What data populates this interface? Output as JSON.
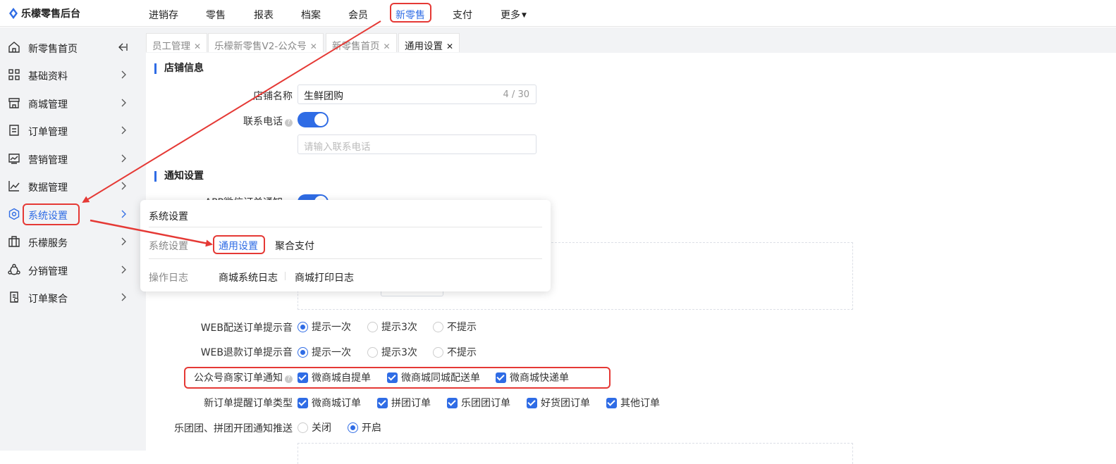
{
  "app": {
    "title": "乐檬零售后台"
  },
  "topnav": [
    "进销存",
    "零售",
    "报表",
    "档案",
    "会员",
    "新零售",
    "支付",
    "更多"
  ],
  "sidebar": {
    "items": [
      {
        "label": "新零售首页",
        "icon": "home-icon"
      },
      {
        "label": "基础资料",
        "icon": "grid-icon"
      },
      {
        "label": "商城管理",
        "icon": "store-icon"
      },
      {
        "label": "订单管理",
        "icon": "order-icon"
      },
      {
        "label": "营销管理",
        "icon": "marketing-icon"
      },
      {
        "label": "数据管理",
        "icon": "chart-icon"
      },
      {
        "label": "系统设置",
        "icon": "hexagon-settings-icon"
      },
      {
        "label": "乐檬服务",
        "icon": "briefcase-icon"
      },
      {
        "label": "分销管理",
        "icon": "share-icon"
      },
      {
        "label": "订单聚合",
        "icon": "clipboard-icon"
      }
    ]
  },
  "tabs": [
    "员工管理",
    "乐檬新零售V2-公众号",
    "新零售首页",
    "通用设置"
  ],
  "shop": {
    "section": "店铺信息",
    "name_label": "店铺名称",
    "name_value": "生鲜团购",
    "name_count": "4 / 30",
    "phone_label": "联系电话",
    "phone_placeholder": "请输入联系电话"
  },
  "notify": {
    "section": "通知设置",
    "app_label": "APP微信订单通知",
    "web_delivery_label": "WEB配送订单提示音",
    "web_refund_label": "WEB退款订单提示音",
    "sound_options": [
      "提示一次",
      "提示3次",
      "不提示"
    ],
    "mp_label": "公众号商家订单通知",
    "mp_options": [
      "微商城自提单",
      "微商城同城配送单",
      "微商城快递单"
    ],
    "new_order_label": "新订单提醒订单类型",
    "new_order_options": [
      "微商城订单",
      "拼团订单",
      "乐团团订单",
      "好货团订单",
      "其他订单"
    ],
    "group_label": "乐团团、拼团开团通知推送",
    "group_options": [
      "关闭",
      "开启"
    ]
  },
  "popup": {
    "title": "系统设置",
    "row1_category": "系统设置",
    "row1_links": [
      "通用设置",
      "聚合支付"
    ],
    "row2_category": "操作日志",
    "row2_links": [
      "商城系统日志",
      "商城打印日志"
    ]
  },
  "colors": {
    "accent": "#2f6ce5",
    "annotation": "#e53935",
    "sidebar_bg": "#f2f3f5"
  }
}
